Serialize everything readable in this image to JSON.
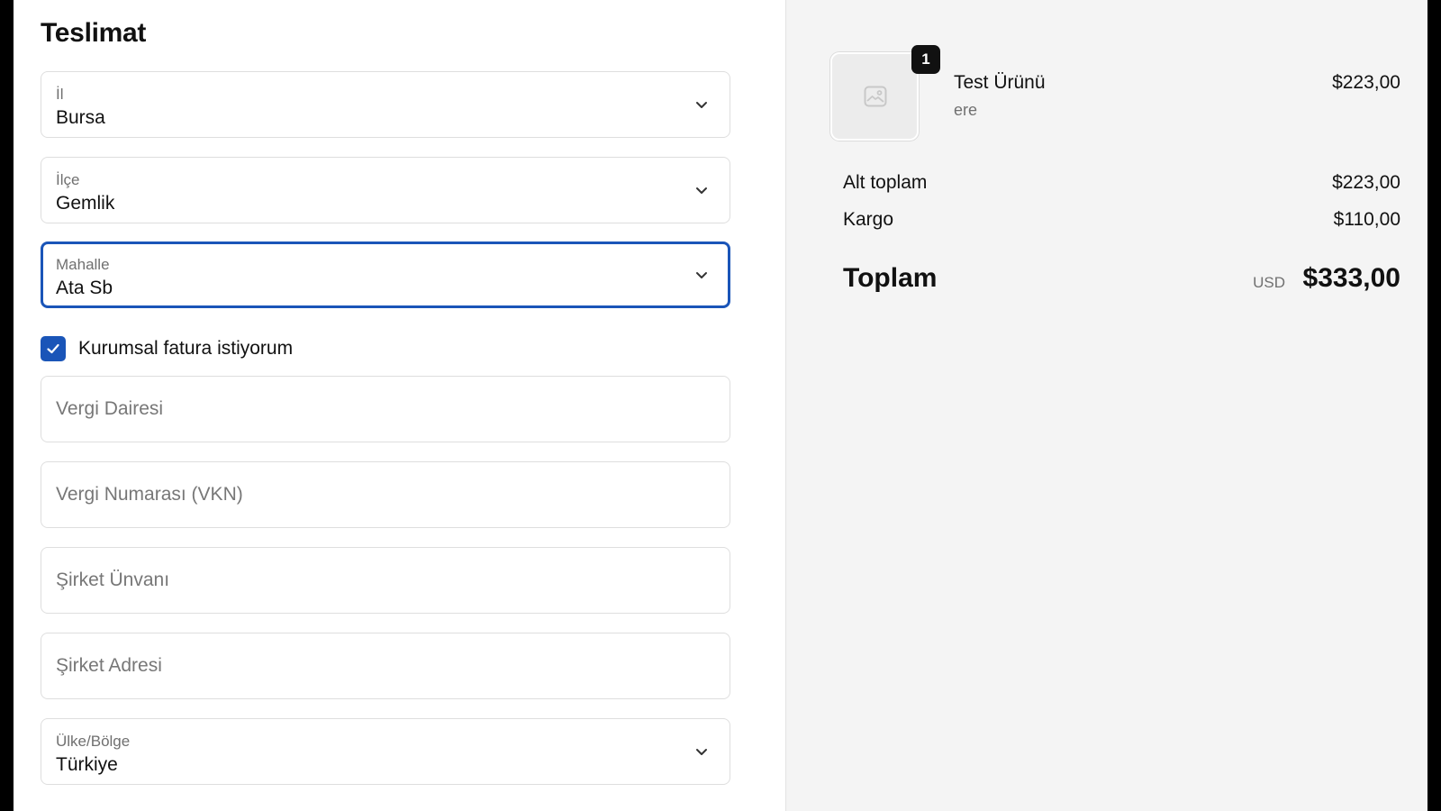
{
  "delivery": {
    "title": "Teslimat",
    "province": {
      "label": "İl",
      "value": "Bursa"
    },
    "district": {
      "label": "İlçe",
      "value": "Gemlik"
    },
    "neighborhood": {
      "label": "Mahalle",
      "value": "Ata Sb"
    },
    "corporate_invoice": {
      "label": "Kurumsal fatura istiyorum",
      "checked": true
    },
    "tax_office": {
      "placeholder": "Vergi Dairesi",
      "value": ""
    },
    "tax_number": {
      "placeholder": "Vergi Numarası (VKN)",
      "value": ""
    },
    "company_title": {
      "placeholder": "Şirket Ünvanı",
      "value": ""
    },
    "company_address": {
      "placeholder": "Şirket Adresi",
      "value": ""
    },
    "country": {
      "label": "Ülke/Bölge",
      "value": "Türkiye"
    }
  },
  "summary": {
    "product": {
      "name": "Test Ürünü",
      "variant": "ere",
      "price": "$223,00",
      "quantity": "1",
      "image_icon": "image-placeholder-icon"
    },
    "subtotal": {
      "label": "Alt toplam",
      "value": "$223,00"
    },
    "shipping": {
      "label": "Kargo",
      "value": "$110,00"
    },
    "total": {
      "label": "Toplam",
      "currency": "USD",
      "value": "$333,00"
    }
  },
  "colors": {
    "accent": "#1a55b8",
    "summary_bg": "#f4f4f4",
    "border": "#dedede"
  }
}
